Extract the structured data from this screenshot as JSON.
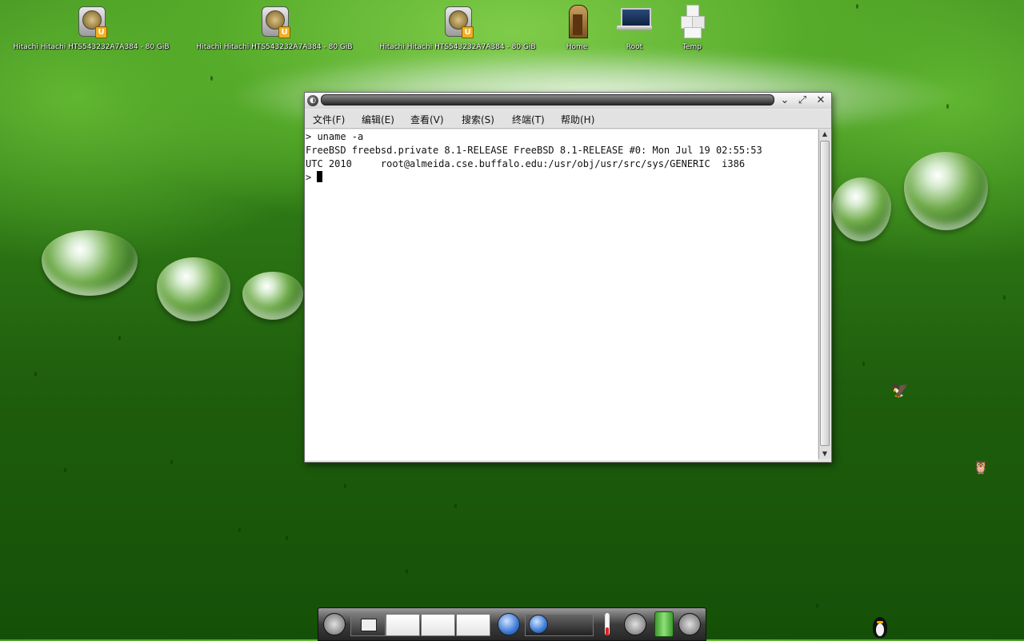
{
  "desktop": {
    "icons": [
      {
        "label": "Hitachi Hitachi HTS543232A7A384 - 80 GiB",
        "icon": "hard-drive-icon"
      },
      {
        "label": "Hitachi Hitachi HTS543232A7A384 - 80 GiB",
        "icon": "hard-drive-icon"
      },
      {
        "label": "Hitachi Hitachi HTS543232A7A384 - 80 GiB",
        "icon": "hard-drive-icon"
      },
      {
        "label": "Home",
        "icon": "home-door-icon"
      },
      {
        "label": "Root",
        "icon": "laptop-icon"
      },
      {
        "label": "Temp",
        "icon": "boxes-icon"
      }
    ]
  },
  "terminal": {
    "menu": [
      "文件(F)",
      "编辑(E)",
      "查看(V)",
      "搜索(S)",
      "终端(T)",
      "帮助(H)"
    ],
    "lines": [
      "> uname -a",
      "FreeBSD freebsd.private 8.1-RELEASE FreeBSD 8.1-RELEASE #0: Mon Jul 19 02:55:53",
      "UTC 2010     root@almeida.cse.buffalo.edu:/usr/obj/usr/src/sys/GENERIC  i386",
      "> "
    ]
  },
  "colors": {
    "accent": "#3f8f1f",
    "dock": "#2a2a2a",
    "terminal_bg": "#ffffff"
  }
}
